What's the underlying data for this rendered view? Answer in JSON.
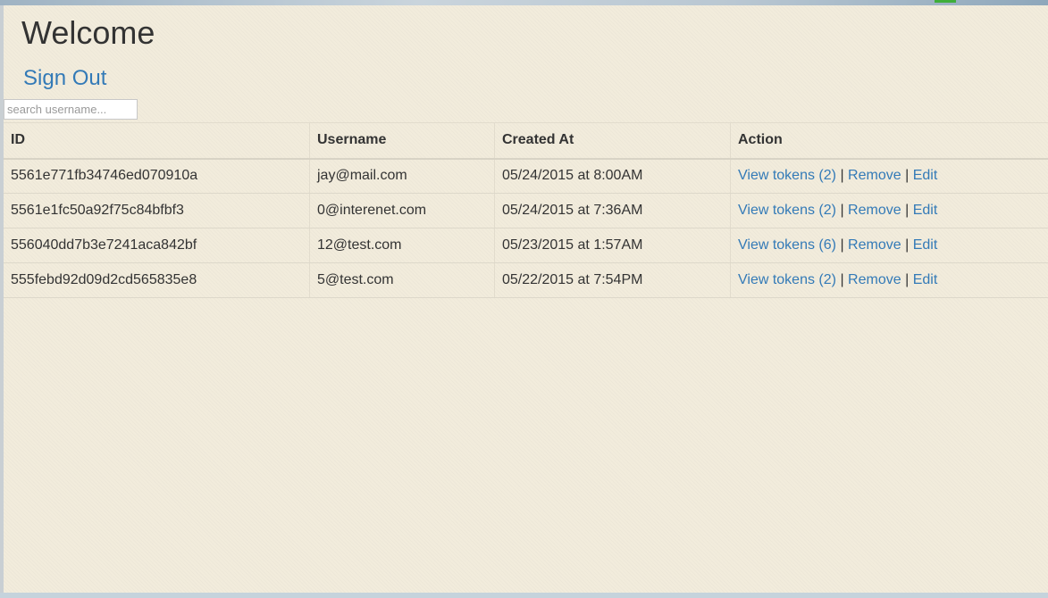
{
  "header": {
    "title": "Welcome",
    "sign_out_label": "Sign Out"
  },
  "search": {
    "placeholder": "search username..."
  },
  "table": {
    "columns": [
      "ID",
      "Username",
      "Created At",
      "Action"
    ],
    "rows": [
      {
        "id": "5561e771fb34746ed070910a",
        "username": "jay@mail.com",
        "created_at": "05/24/2015 at 8:00AM",
        "view_tokens": "View tokens (2)",
        "remove": "Remove",
        "edit": "Edit"
      },
      {
        "id": "5561e1fc50a92f75c84bfbf3",
        "username": "0@interenet.com",
        "created_at": "05/24/2015 at 7:36AM",
        "view_tokens": "View tokens (2)",
        "remove": "Remove",
        "edit": "Edit"
      },
      {
        "id": "556040dd7b3e7241aca842bf",
        "username": "12@test.com",
        "created_at": "05/23/2015 at 1:57AM",
        "view_tokens": "View tokens (6)",
        "remove": "Remove",
        "edit": "Edit"
      },
      {
        "id": "555febd92d09d2cd565835e8",
        "username": "5@test.com",
        "created_at": "05/22/2015 at 7:54PM",
        "view_tokens": "View tokens (2)",
        "remove": "Remove",
        "edit": "Edit"
      }
    ],
    "separator": "|"
  },
  "colors": {
    "link": "#337ab7",
    "text": "#333333",
    "background": "#f2ecdc"
  }
}
